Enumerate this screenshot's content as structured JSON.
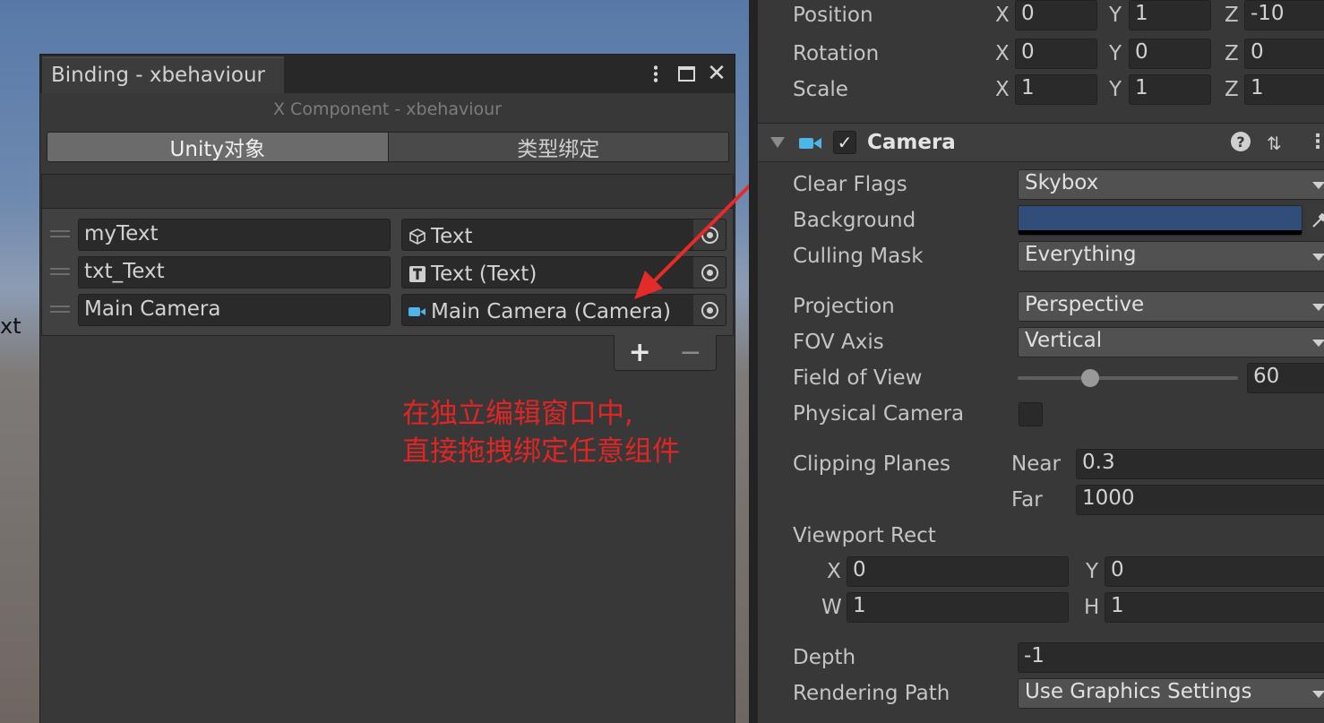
{
  "scene": {
    "partial_text": "xt"
  },
  "binding_window": {
    "tab_title": "Binding - xbehaviour",
    "component_title": "X Component - xbehaviour",
    "tabs": [
      {
        "label": "Unity对象",
        "selected": true
      },
      {
        "label": "类型绑定",
        "selected": false
      }
    ],
    "rows": [
      {
        "name": "myText",
        "object": "Text",
        "icon": "gameobject-cube-icon"
      },
      {
        "name": "txt_Text",
        "object": "Text (Text)",
        "icon": "text-component-icon"
      },
      {
        "name": "Main Camera",
        "object": "Main Camera (Camera)",
        "icon": "camera-icon"
      }
    ],
    "add_label": "+",
    "remove_label": "−"
  },
  "annotation": {
    "line1": "在独立编辑窗口中,",
    "line2": "直接拖拽绑定任意组件",
    "color": "#e02525"
  },
  "inspector": {
    "transform": {
      "position": {
        "label": "Position",
        "x": "0",
        "y": "1",
        "z": "-10"
      },
      "rotation": {
        "label": "Rotation",
        "x": "0",
        "y": "0",
        "z": "0"
      },
      "scale": {
        "label": "Scale",
        "x": "1",
        "y": "1",
        "z": "1"
      },
      "axis_x": "X",
      "axis_y": "Y",
      "axis_z": "Z"
    },
    "camera": {
      "title": "Camera",
      "enabled": true,
      "help": "?",
      "presets": "⇅",
      "menu": "⋮",
      "clear_flags": {
        "label": "Clear Flags",
        "value": "Skybox"
      },
      "background": {
        "label": "Background",
        "color": "#314d79"
      },
      "culling_mask": {
        "label": "Culling Mask",
        "value": "Everything"
      },
      "projection": {
        "label": "Projection",
        "value": "Perspective"
      },
      "fov_axis": {
        "label": "FOV Axis",
        "value": "Vertical"
      },
      "field_of_view": {
        "label": "Field of View",
        "value": "60",
        "slider_fraction": 0.33
      },
      "physical_camera": {
        "label": "Physical Camera",
        "checked": false
      },
      "clipping_planes": {
        "label": "Clipping Planes",
        "near_label": "Near",
        "near": "0.3",
        "far_label": "Far",
        "far": "1000"
      },
      "viewport_rect": {
        "label": "Viewport Rect",
        "x_label": "X",
        "x": "0",
        "y_label": "Y",
        "y": "0",
        "w_label": "W",
        "w": "1",
        "h_label": "H",
        "h": "1"
      },
      "depth": {
        "label": "Depth",
        "value": "-1"
      },
      "rendering_path": {
        "label": "Rendering Path",
        "value": "Use Graphics Settings"
      }
    }
  }
}
